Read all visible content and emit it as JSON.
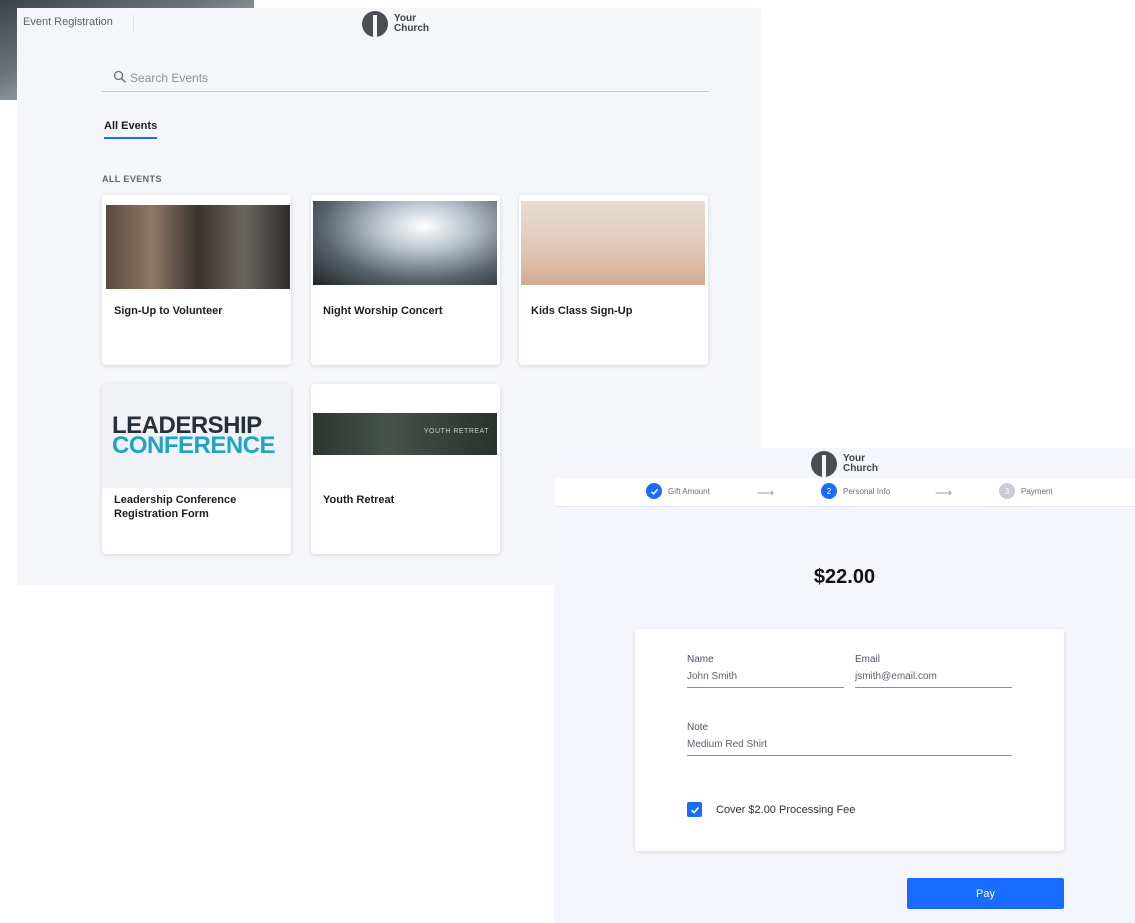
{
  "brand": {
    "logo_line1": "Your",
    "logo_line2": "Church",
    "accent_color": "#1a6cff"
  },
  "events_page": {
    "header_title": "Event Registration",
    "search": {
      "placeholder": "Search Events",
      "icon": "search-icon"
    },
    "tabs": [
      {
        "label": "All Events",
        "active": true
      }
    ],
    "section_label": "ALL EVENTS",
    "events": [
      {
        "title": "Sign-Up to Volunteer"
      },
      {
        "title": "Night Worship Concert"
      },
      {
        "title": "Kids Class Sign-Up"
      },
      {
        "title": "Leadership Conference Registration Form",
        "image_text_1": "LEADERSHIP",
        "image_text_2": "CONFERENCE"
      },
      {
        "title": "Youth Retreat",
        "image_text": "YOUTH RETREAT"
      }
    ]
  },
  "payment_page": {
    "steps": [
      {
        "label": "Gift Amount",
        "state": "done",
        "number": "1"
      },
      {
        "label": "Personal Info",
        "state": "active",
        "number": "2"
      },
      {
        "label": "Payment",
        "state": "todo",
        "number": "3"
      }
    ],
    "amount": "$22.00",
    "form": {
      "name": {
        "label": "Name",
        "value": "John Smith"
      },
      "email": {
        "label": "Email",
        "value": "jsmith@email.com"
      },
      "note": {
        "label": "Note",
        "value": "Medium Red Shirt"
      },
      "processing_fee": {
        "label": "Cover $2.00 Processing Fee",
        "checked": true
      }
    },
    "pay_button": "Pay"
  }
}
